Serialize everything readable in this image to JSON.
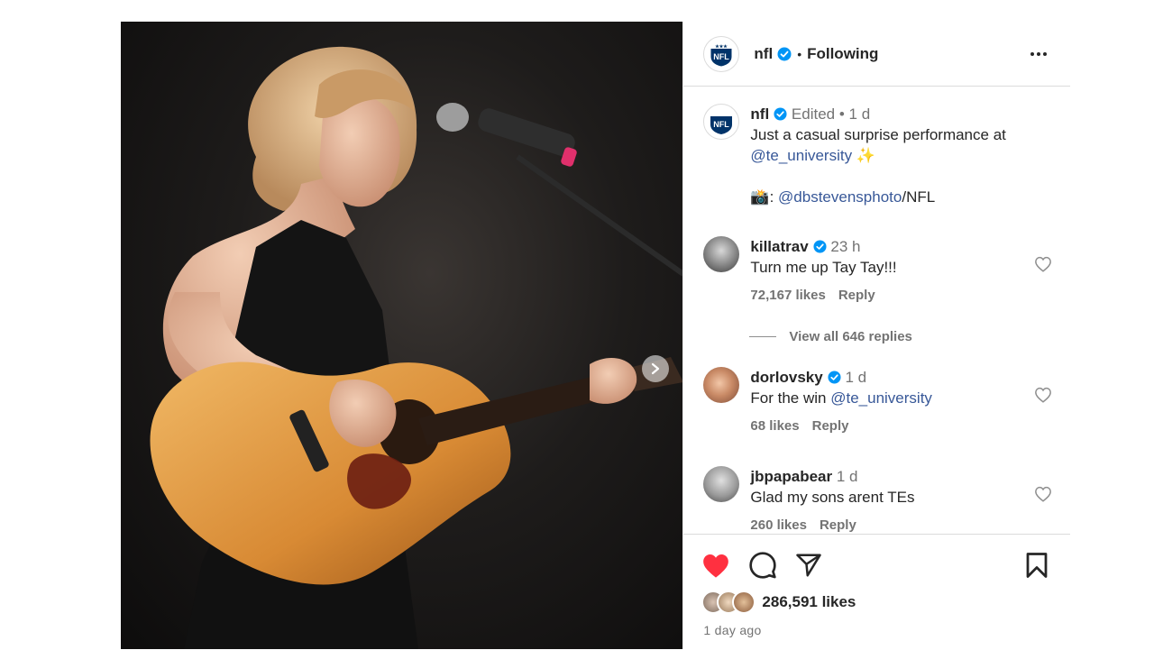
{
  "post": {
    "author": "nfl",
    "follow_status": "Following",
    "caption": {
      "author": "nfl",
      "edited": "Edited",
      "time": "1 d",
      "text": "Just a casual surprise performance at",
      "mention": "@te_university",
      "sparkle": "✨",
      "camera": "📸",
      "credit_sep": ":",
      "credit_mention": "@dbstevensphoto",
      "credit_suffix": "/NFL"
    }
  },
  "comments": [
    {
      "user": "killatrav",
      "verified": true,
      "time": "23 h",
      "text": "Turn me up Tay Tay!!!",
      "likes": "72,167 likes",
      "reply": "Reply",
      "view_replies": "View all 646 replies"
    },
    {
      "user": "dorlovsky",
      "verified": true,
      "time": "1 d",
      "text": "For the win",
      "mention": "@te_university",
      "likes": "68 likes",
      "reply": "Reply"
    },
    {
      "user": "jbpapabear",
      "verified": false,
      "time": "1 d",
      "text": "Glad my sons arent TEs",
      "likes": "260 likes",
      "reply": "Reply"
    }
  ],
  "footer": {
    "likes": "286,591 likes",
    "date": "1 day ago"
  },
  "colors": {
    "heart_red": "#ff3040",
    "verified_blue": "#0095f6",
    "link_blue": "#385898",
    "muted": "#737373"
  },
  "icons": [
    "nfl-logo",
    "verified-badge",
    "more-icon",
    "heart-icon",
    "comment-icon",
    "share-icon",
    "bookmark-icon",
    "carousel-next-icon"
  ]
}
